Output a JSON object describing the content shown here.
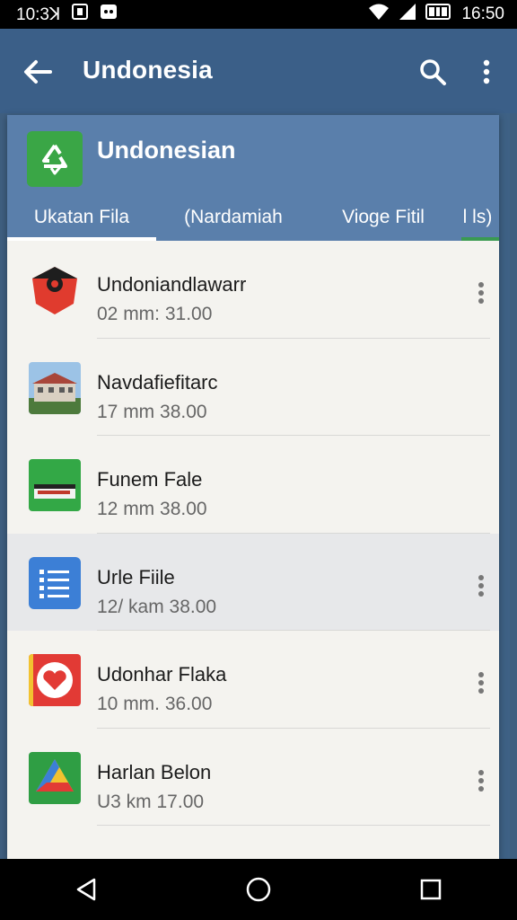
{
  "status_bar": {
    "time_left": "10:3ꓘ",
    "time_right": "16:50"
  },
  "app_bar": {
    "title": "Undonesia",
    "icons": [
      "back-arrow-icon",
      "search-icon",
      "more-vert-icon"
    ]
  },
  "sheet": {
    "title": "Undonesian",
    "folder_icon": "recycle-folder-icon",
    "tabs": [
      {
        "label": "Ukatan Fila",
        "selected": true
      },
      {
        "label": "(Nardamiah",
        "selected": false
      },
      {
        "label": "Vioge Fitil",
        "selected": false
      },
      {
        "label": "l ls)",
        "selected": false
      }
    ]
  },
  "list": [
    {
      "title": "Undoniandlawarr",
      "subtitle": "02 mm: 31.00",
      "icon": "red-shield-icon",
      "has_menu": true,
      "selected": false
    },
    {
      "title": "Navdafiefitarc",
      "subtitle": "17 mm 38.00",
      "icon": "building-photo-icon",
      "has_menu": false,
      "selected": false
    },
    {
      "title": "Funem Fale",
      "subtitle": "12 mm 38.00",
      "icon": "green-media-icon",
      "has_menu": false,
      "selected": false
    },
    {
      "title": "Urle Fiile",
      "subtitle": "12/ kam 38.00",
      "icon": "blue-list-icon",
      "has_menu": true,
      "selected": true
    },
    {
      "title": "Udonhar Flaka",
      "subtitle": "10 mm. 36.00",
      "icon": "red-heart-icon",
      "has_menu": true,
      "selected": false
    },
    {
      "title": "Harlan Belon",
      "subtitle": "U3 km 17.00",
      "icon": "colorful-drive-icon",
      "has_menu": true,
      "selected": false
    }
  ],
  "nav_bar": {
    "icons": [
      "back-triangle-icon",
      "home-circle-icon",
      "recents-square-icon"
    ]
  },
  "colors": {
    "app_bar": "#3b5f88",
    "sheet_header": "#5a7fab",
    "sheet_bg": "#f4f3ef",
    "accent_green": "#3aa646"
  }
}
